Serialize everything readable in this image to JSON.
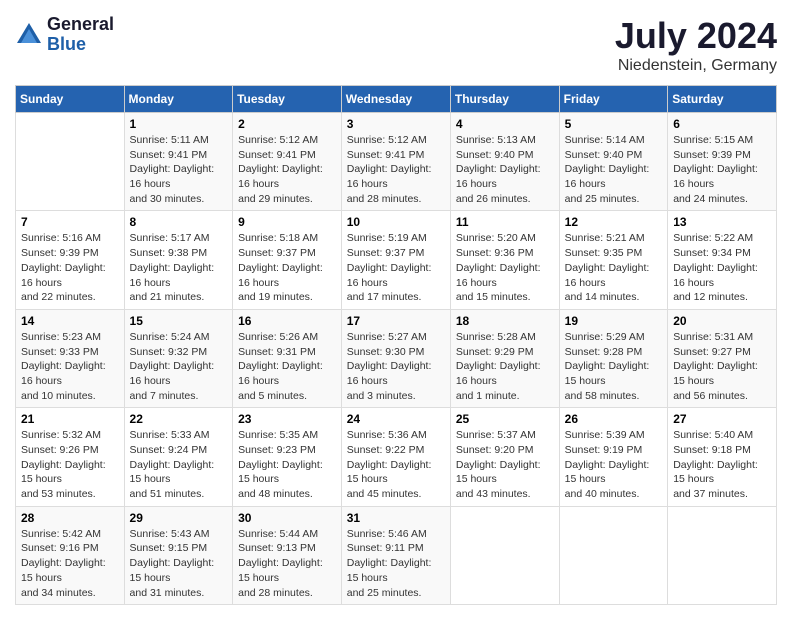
{
  "header": {
    "logo_line1": "General",
    "logo_line2": "Blue",
    "month_year": "July 2024",
    "location": "Niedenstein, Germany"
  },
  "days_of_week": [
    "Sunday",
    "Monday",
    "Tuesday",
    "Wednesday",
    "Thursday",
    "Friday",
    "Saturday"
  ],
  "weeks": [
    [
      {
        "day": "",
        "sunrise": "",
        "sunset": "",
        "daylight": ""
      },
      {
        "day": "1",
        "sunrise": "Sunrise: 5:11 AM",
        "sunset": "Sunset: 9:41 PM",
        "daylight": "Daylight: 16 hours and 30 minutes."
      },
      {
        "day": "2",
        "sunrise": "Sunrise: 5:12 AM",
        "sunset": "Sunset: 9:41 PM",
        "daylight": "Daylight: 16 hours and 29 minutes."
      },
      {
        "day": "3",
        "sunrise": "Sunrise: 5:12 AM",
        "sunset": "Sunset: 9:41 PM",
        "daylight": "Daylight: 16 hours and 28 minutes."
      },
      {
        "day": "4",
        "sunrise": "Sunrise: 5:13 AM",
        "sunset": "Sunset: 9:40 PM",
        "daylight": "Daylight: 16 hours and 26 minutes."
      },
      {
        "day": "5",
        "sunrise": "Sunrise: 5:14 AM",
        "sunset": "Sunset: 9:40 PM",
        "daylight": "Daylight: 16 hours and 25 minutes."
      },
      {
        "day": "6",
        "sunrise": "Sunrise: 5:15 AM",
        "sunset": "Sunset: 9:39 PM",
        "daylight": "Daylight: 16 hours and 24 minutes."
      }
    ],
    [
      {
        "day": "7",
        "sunrise": "Sunrise: 5:16 AM",
        "sunset": "Sunset: 9:39 PM",
        "daylight": "Daylight: 16 hours and 22 minutes."
      },
      {
        "day": "8",
        "sunrise": "Sunrise: 5:17 AM",
        "sunset": "Sunset: 9:38 PM",
        "daylight": "Daylight: 16 hours and 21 minutes."
      },
      {
        "day": "9",
        "sunrise": "Sunrise: 5:18 AM",
        "sunset": "Sunset: 9:37 PM",
        "daylight": "Daylight: 16 hours and 19 minutes."
      },
      {
        "day": "10",
        "sunrise": "Sunrise: 5:19 AM",
        "sunset": "Sunset: 9:37 PM",
        "daylight": "Daylight: 16 hours and 17 minutes."
      },
      {
        "day": "11",
        "sunrise": "Sunrise: 5:20 AM",
        "sunset": "Sunset: 9:36 PM",
        "daylight": "Daylight: 16 hours and 15 minutes."
      },
      {
        "day": "12",
        "sunrise": "Sunrise: 5:21 AM",
        "sunset": "Sunset: 9:35 PM",
        "daylight": "Daylight: 16 hours and 14 minutes."
      },
      {
        "day": "13",
        "sunrise": "Sunrise: 5:22 AM",
        "sunset": "Sunset: 9:34 PM",
        "daylight": "Daylight: 16 hours and 12 minutes."
      }
    ],
    [
      {
        "day": "14",
        "sunrise": "Sunrise: 5:23 AM",
        "sunset": "Sunset: 9:33 PM",
        "daylight": "Daylight: 16 hours and 10 minutes."
      },
      {
        "day": "15",
        "sunrise": "Sunrise: 5:24 AM",
        "sunset": "Sunset: 9:32 PM",
        "daylight": "Daylight: 16 hours and 7 minutes."
      },
      {
        "day": "16",
        "sunrise": "Sunrise: 5:26 AM",
        "sunset": "Sunset: 9:31 PM",
        "daylight": "Daylight: 16 hours and 5 minutes."
      },
      {
        "day": "17",
        "sunrise": "Sunrise: 5:27 AM",
        "sunset": "Sunset: 9:30 PM",
        "daylight": "Daylight: 16 hours and 3 minutes."
      },
      {
        "day": "18",
        "sunrise": "Sunrise: 5:28 AM",
        "sunset": "Sunset: 9:29 PM",
        "daylight": "Daylight: 16 hours and 1 minute."
      },
      {
        "day": "19",
        "sunrise": "Sunrise: 5:29 AM",
        "sunset": "Sunset: 9:28 PM",
        "daylight": "Daylight: 15 hours and 58 minutes."
      },
      {
        "day": "20",
        "sunrise": "Sunrise: 5:31 AM",
        "sunset": "Sunset: 9:27 PM",
        "daylight": "Daylight: 15 hours and 56 minutes."
      }
    ],
    [
      {
        "day": "21",
        "sunrise": "Sunrise: 5:32 AM",
        "sunset": "Sunset: 9:26 PM",
        "daylight": "Daylight: 15 hours and 53 minutes."
      },
      {
        "day": "22",
        "sunrise": "Sunrise: 5:33 AM",
        "sunset": "Sunset: 9:24 PM",
        "daylight": "Daylight: 15 hours and 51 minutes."
      },
      {
        "day": "23",
        "sunrise": "Sunrise: 5:35 AM",
        "sunset": "Sunset: 9:23 PM",
        "daylight": "Daylight: 15 hours and 48 minutes."
      },
      {
        "day": "24",
        "sunrise": "Sunrise: 5:36 AM",
        "sunset": "Sunset: 9:22 PM",
        "daylight": "Daylight: 15 hours and 45 minutes."
      },
      {
        "day": "25",
        "sunrise": "Sunrise: 5:37 AM",
        "sunset": "Sunset: 9:20 PM",
        "daylight": "Daylight: 15 hours and 43 minutes."
      },
      {
        "day": "26",
        "sunrise": "Sunrise: 5:39 AM",
        "sunset": "Sunset: 9:19 PM",
        "daylight": "Daylight: 15 hours and 40 minutes."
      },
      {
        "day": "27",
        "sunrise": "Sunrise: 5:40 AM",
        "sunset": "Sunset: 9:18 PM",
        "daylight": "Daylight: 15 hours and 37 minutes."
      }
    ],
    [
      {
        "day": "28",
        "sunrise": "Sunrise: 5:42 AM",
        "sunset": "Sunset: 9:16 PM",
        "daylight": "Daylight: 15 hours and 34 minutes."
      },
      {
        "day": "29",
        "sunrise": "Sunrise: 5:43 AM",
        "sunset": "Sunset: 9:15 PM",
        "daylight": "Daylight: 15 hours and 31 minutes."
      },
      {
        "day": "30",
        "sunrise": "Sunrise: 5:44 AM",
        "sunset": "Sunset: 9:13 PM",
        "daylight": "Daylight: 15 hours and 28 minutes."
      },
      {
        "day": "31",
        "sunrise": "Sunrise: 5:46 AM",
        "sunset": "Sunset: 9:11 PM",
        "daylight": "Daylight: 15 hours and 25 minutes."
      },
      {
        "day": "",
        "sunrise": "",
        "sunset": "",
        "daylight": ""
      },
      {
        "day": "",
        "sunrise": "",
        "sunset": "",
        "daylight": ""
      },
      {
        "day": "",
        "sunrise": "",
        "sunset": "",
        "daylight": ""
      }
    ]
  ]
}
